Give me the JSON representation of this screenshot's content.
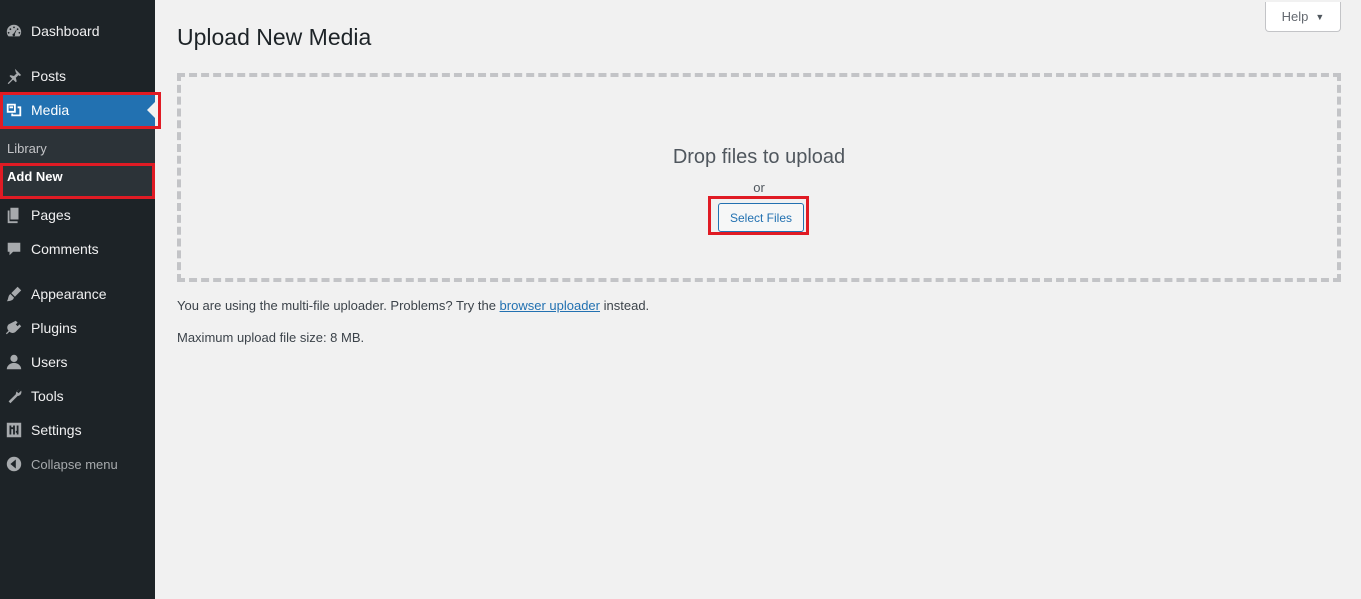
{
  "sidebar": {
    "items": [
      {
        "label": "Dashboard",
        "icon": "dashboard-icon"
      },
      {
        "label": "Posts",
        "icon": "pin-icon"
      },
      {
        "label": "Media",
        "icon": "media-icon"
      },
      {
        "label": "Pages",
        "icon": "pages-icon"
      },
      {
        "label": "Comments",
        "icon": "comment-icon"
      },
      {
        "label": "Appearance",
        "icon": "brush-icon"
      },
      {
        "label": "Plugins",
        "icon": "plugin-icon"
      },
      {
        "label": "Users",
        "icon": "user-icon"
      },
      {
        "label": "Tools",
        "icon": "wrench-icon"
      },
      {
        "label": "Settings",
        "icon": "settings-icon"
      }
    ],
    "submenu": [
      {
        "label": "Library"
      },
      {
        "label": "Add New"
      }
    ],
    "collapse_label": "Collapse menu"
  },
  "header": {
    "help_label": "Help",
    "page_title": "Upload New Media"
  },
  "uploader": {
    "drop_text": "Drop files to upload",
    "or_text": "or",
    "select_button": "Select Files"
  },
  "info": {
    "multi_prefix": "You are using the multi-file uploader. Problems? Try the",
    "browser_link": "browser uploader",
    "multi_suffix": "instead.",
    "max_size": "Maximum upload file size: 8 MB."
  },
  "colors": {
    "sidebar_bg": "#1d2327",
    "accent": "#2271b1",
    "highlight": "#e01b24"
  }
}
